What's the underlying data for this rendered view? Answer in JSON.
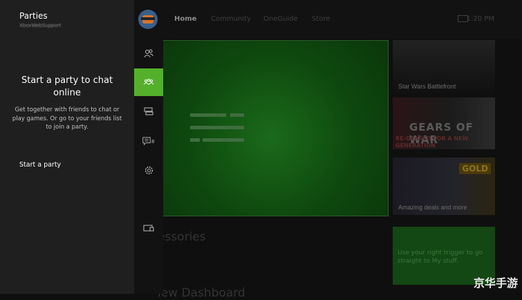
{
  "guide": {
    "title": "Parties",
    "gamertag": "XboxWebSupport",
    "heading": "Start a party to chat online",
    "description": "Get together with friends to chat or play games. Or go to your friends list to join a party.",
    "start_party_label": "Start a party"
  },
  "rail": {
    "items": [
      {
        "name": "friends-icon",
        "label": ""
      },
      {
        "name": "party-icon",
        "label": "",
        "active": true
      },
      {
        "name": "messages-icon",
        "label": ""
      },
      {
        "name": "notifications-icon",
        "label": "8"
      },
      {
        "name": "settings-icon",
        "label": ""
      },
      {
        "name": "snap-icon",
        "label": ""
      }
    ]
  },
  "dashboard": {
    "tabs": [
      "Home",
      "Community",
      "OneGuide",
      "Store"
    ],
    "time": "1:20 PM",
    "tiles": {
      "starwars": "Star Wars Battlefront",
      "gears_title": "GEARS OF WAR",
      "gears_sub": "RE-GEARED FOR A NEW GENERATION",
      "gold_badge": "GOLD",
      "gold_label": "Amazing deals and more",
      "cta": "Use your right trigger to go straight to My stuff."
    },
    "bg_heading_1": "essories",
    "bg_heading_2": "iew Dashboard"
  },
  "watermark": "京华手游",
  "colors": {
    "accent": "#54b02b",
    "panel": "#1f1f1f",
    "rail": "#121212",
    "hero": "#0e480e"
  }
}
